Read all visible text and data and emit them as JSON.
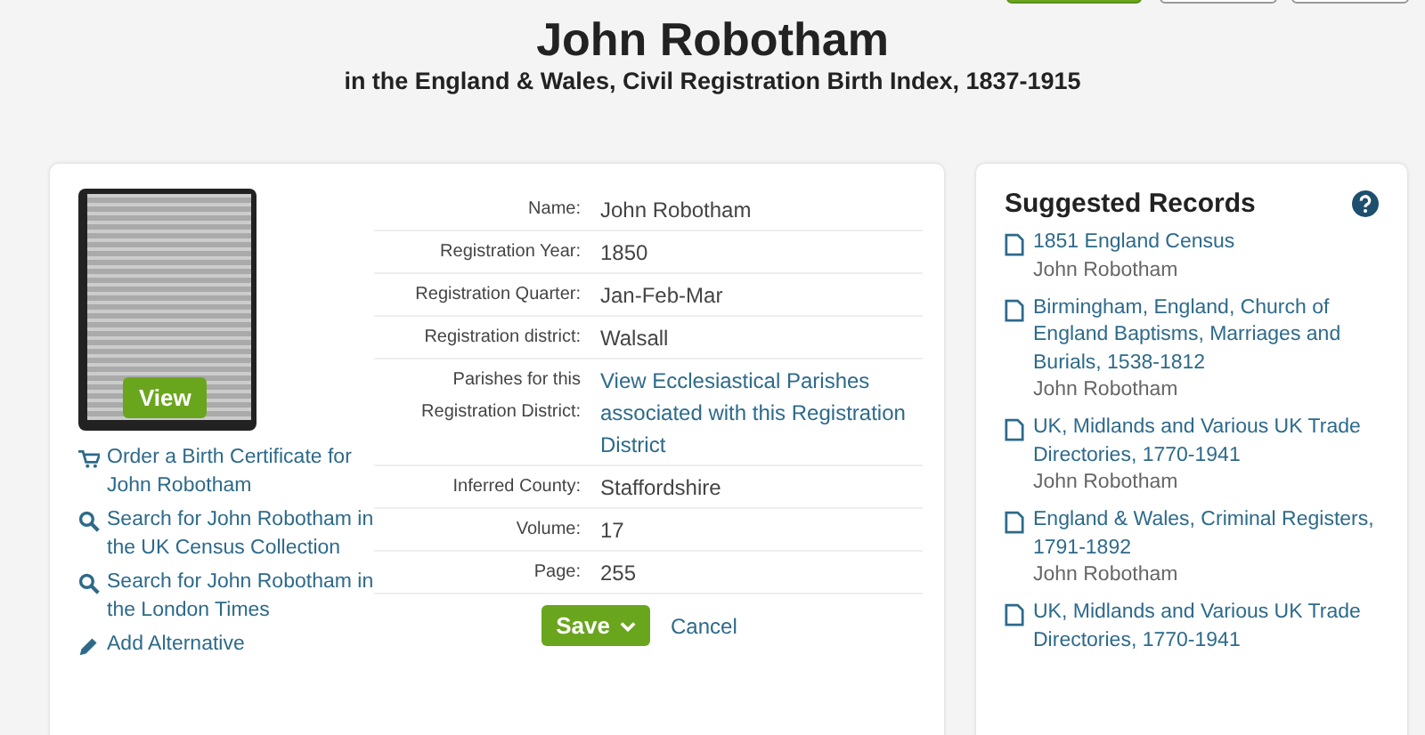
{
  "header": {
    "title": "John Robotham",
    "subtitle": "in the England & Wales, Civil Registration Birth Index, 1837-1915"
  },
  "record_image": {
    "view_button": "View"
  },
  "actions": [
    {
      "kind": "cart",
      "label": "Order a Birth Certificate for John Robotham"
    },
    {
      "kind": "search",
      "label": "Search for John Robotham in the UK Census Collection"
    },
    {
      "kind": "search",
      "label": "Search for John Robotham in the London Times"
    },
    {
      "kind": "edit",
      "label": "Add Alternative"
    }
  ],
  "fields": [
    {
      "label": "Name:",
      "value": "John Robotham",
      "link": false
    },
    {
      "label": "Registration Year:",
      "value": "1850",
      "link": false
    },
    {
      "label": "Registration Quarter:",
      "value": "Jan-Feb-Mar",
      "link": false
    },
    {
      "label": "Registration district:",
      "value": "Walsall",
      "link": false
    },
    {
      "label": "Parishes for this Registration District:",
      "value": "View Ecclesiastical Parishes associated with this Registration District",
      "link": true
    },
    {
      "label": "Inferred County:",
      "value": "Staffordshire",
      "link": false
    },
    {
      "label": "Volume:",
      "value": "17",
      "link": false
    },
    {
      "label": "Page:",
      "value": "255",
      "link": false
    }
  ],
  "buttons": {
    "save": "Save",
    "cancel": "Cancel"
  },
  "suggested": {
    "title": "Suggested Records",
    "items": [
      {
        "title": "1851 England Census",
        "name": "John Robotham"
      },
      {
        "title": "Birmingham, England, Church of England Baptisms, Marriages and Burials, 1538-1812",
        "name": "John Robotham"
      },
      {
        "title": "UK, Midlands and Various UK Trade Directories, 1770-1941",
        "name": "John Robotham"
      },
      {
        "title": "England & Wales, Criminal Registers, 1791-1892",
        "name": "John Robotham"
      },
      {
        "title": "UK, Midlands and Various UK Trade Directories, 1770-1941"
      }
    ]
  }
}
